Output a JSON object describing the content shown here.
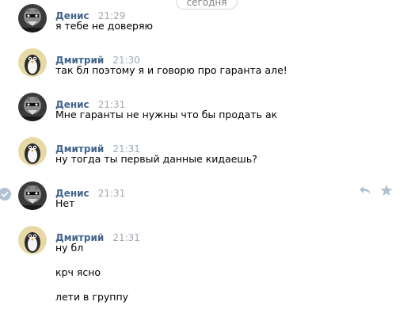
{
  "date_divider": "сегодня",
  "messages": [
    {
      "author": "Денис",
      "time": "21:29",
      "lines": [
        "я тебе не доверяю"
      ]
    },
    {
      "author": "Дмитрий",
      "time": "21:30",
      "lines": [
        "так бл поэтому я и говорю про гаранта але!"
      ]
    },
    {
      "author": "Денис",
      "time": "21:31",
      "lines": [
        "Мне гаранты не нужны что бы продать ак"
      ]
    },
    {
      "author": "Дмитрий",
      "time": "21:31",
      "lines": [
        "ну тогда ты первый данные кидаешь?"
      ]
    },
    {
      "author": "Денис",
      "time": "21:31",
      "lines": [
        "Нет"
      ]
    },
    {
      "author": "Дмитрий",
      "time": "21:31",
      "lines": [
        "ну бл",
        "крч ясно",
        "лети в группу"
      ]
    }
  ],
  "icons": {
    "selected_check": "check-icon",
    "reply": "reply-icon",
    "favorite": "star-icon"
  },
  "colors": {
    "author": "#42648b",
    "time": "#a0a9b3",
    "icon": "#b2c1d1",
    "divider_border": "#d3d9de"
  }
}
